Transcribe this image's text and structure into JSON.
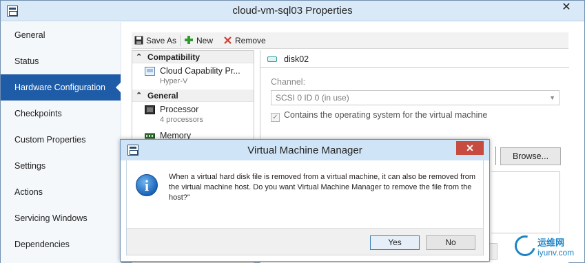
{
  "window": {
    "title": "cloud-vm-sql03 Properties",
    "close_glyph": "✕"
  },
  "sidebar": {
    "items": [
      {
        "label": "General"
      },
      {
        "label": "Status"
      },
      {
        "label": "Hardware Configuration",
        "active": true
      },
      {
        "label": "Checkpoints"
      },
      {
        "label": "Custom Properties"
      },
      {
        "label": "Settings"
      },
      {
        "label": "Actions"
      },
      {
        "label": "Servicing Windows"
      },
      {
        "label": "Dependencies"
      }
    ]
  },
  "toolbar": {
    "save_as": "Save As",
    "new": "New",
    "remove": "Remove"
  },
  "hardware": {
    "groups": [
      {
        "label": "Compatibility",
        "items": [
          {
            "name": "Cloud Capability Pr...",
            "sub": "Hyper-V"
          }
        ]
      },
      {
        "label": "General",
        "items": [
          {
            "name": "Processor",
            "sub": "4 processors"
          },
          {
            "name": "Memory",
            "sub": ""
          }
        ]
      }
    ]
  },
  "detail": {
    "disk_name": "disk02",
    "channel_label": "Channel:",
    "channel_value": "SCSI 0 ID 0 (in use)",
    "os_checkbox_label": "Contains the operating system for the virtual machine",
    "os_checked": true,
    "browse_label": "Browse..."
  },
  "dialog": {
    "title": "Virtual Machine Manager",
    "close_glyph": "✕",
    "message": "When a virtual hard disk file is removed from a virtual machine, it can also be removed from the virtual machine host. Do you want Virtual Machine Manager to remove the file from the host?\"",
    "yes_label": "Yes",
    "no_label": "No"
  },
  "watermark": {
    "line1": "运维网",
    "line2": "iyunv.com"
  },
  "colors": {
    "accent": "#1f5ca8",
    "titlebar": "#d9e9f7",
    "dialog_close": "#c74b3f"
  }
}
